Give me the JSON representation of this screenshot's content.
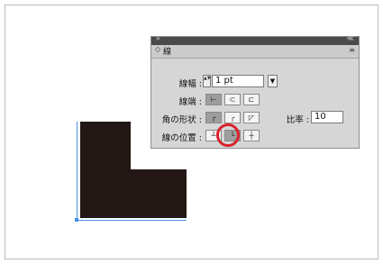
{
  "panel": {
    "title": "線",
    "tab_arrows": "◇",
    "titlebar_left": "»",
    "titlebar_right": "≪",
    "menu_icon": "≡"
  },
  "weight": {
    "label": "線幅 :",
    "value": "1 pt",
    "stepper": "▲▼",
    "dropdown": "▼"
  },
  "cap": {
    "label": "線端 :",
    "options": [
      "butt-cap",
      "round-cap",
      "projecting-cap"
    ],
    "selected": 0
  },
  "corner": {
    "label": "角の形状 :",
    "options": [
      "miter-join",
      "round-join",
      "bevel-join"
    ],
    "selected": 0
  },
  "limit": {
    "label": "比率 :",
    "value": "10"
  },
  "align": {
    "label": "線の位置 :",
    "options": [
      "align-center",
      "align-inside",
      "align-outside"
    ],
    "selected": 1
  },
  "colors": {
    "shape": "#231815",
    "path": "#4a90e2",
    "highlight": "#d9222a"
  }
}
